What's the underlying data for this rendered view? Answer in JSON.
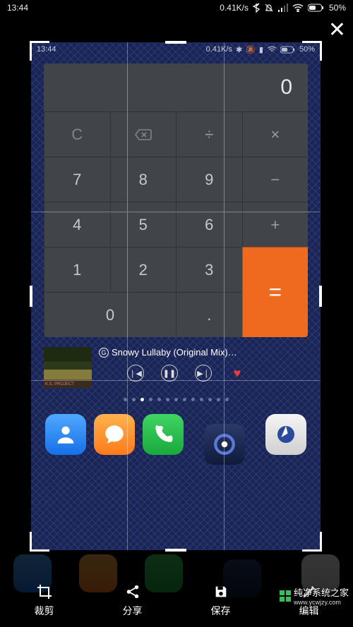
{
  "outer_status": {
    "time": "13:44",
    "net_speed": "0.41K/s",
    "battery_pct": "50%"
  },
  "inner_status": {
    "time": "13:44",
    "net_speed": "0.41K/s",
    "battery_pct": "50%"
  },
  "calculator": {
    "display": "0",
    "keys": {
      "clear": "C",
      "divide": "÷",
      "multiply": "×",
      "7": "7",
      "8": "8",
      "9": "9",
      "minus": "−",
      "4": "4",
      "5": "5",
      "6": "6",
      "plus": "+",
      "1": "1",
      "2": "2",
      "3": "3",
      "equals": "=",
      "0": "0",
      "dot": "."
    }
  },
  "music": {
    "track_title": "Snowy Lullaby (Original Mix)…",
    "album_caption": "K.S. PROJECT"
  },
  "pager": {
    "count": 13,
    "active_index": 2
  },
  "dock": {
    "apps": [
      "contacts",
      "messages",
      "phone",
      "music",
      "browser"
    ]
  },
  "toolbar": {
    "crop": "裁剪",
    "share": "分享",
    "save": "保存",
    "edit": "编辑"
  },
  "watermark": {
    "line1": "纯净系统之家",
    "line2": "www.ycwjzy.com"
  }
}
